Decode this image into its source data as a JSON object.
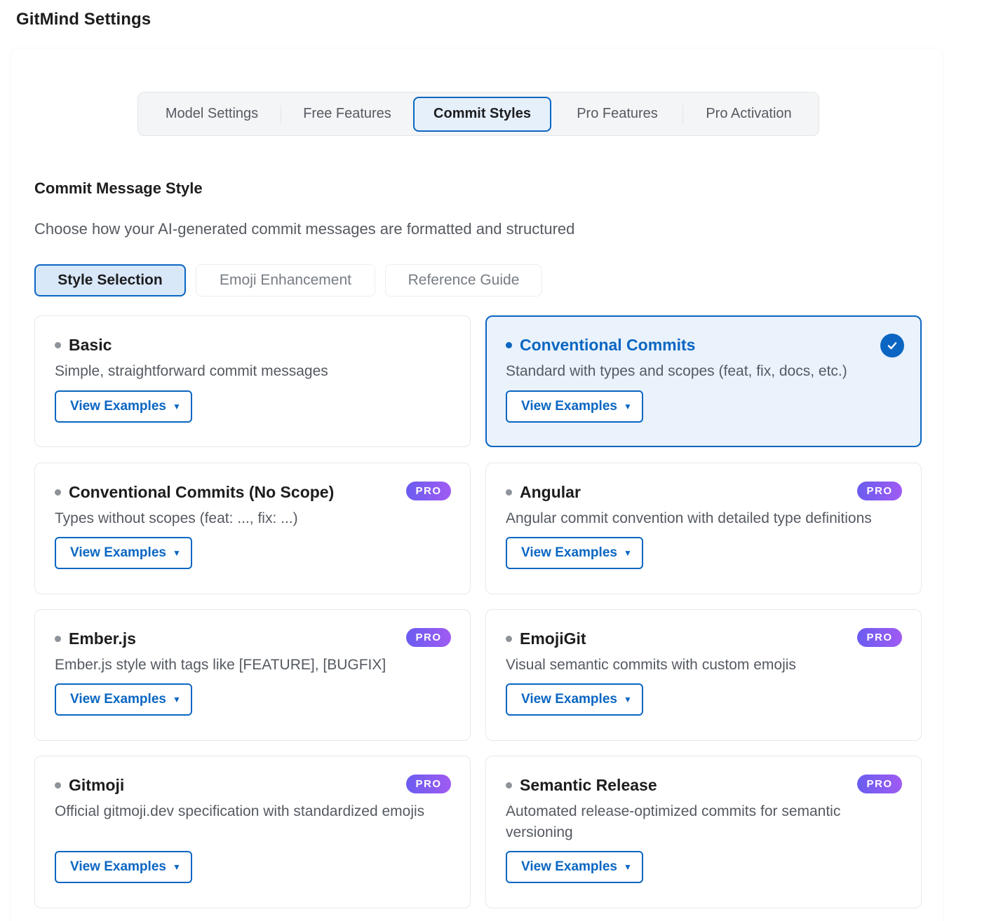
{
  "header": {
    "title": "GitMind Settings"
  },
  "main_tabs": [
    {
      "label": "Model Settings",
      "active": false
    },
    {
      "label": "Free Features",
      "active": false
    },
    {
      "label": "Commit Styles",
      "active": true
    },
    {
      "label": "Pro Features",
      "active": false
    },
    {
      "label": "Pro Activation",
      "active": false
    }
  ],
  "section": {
    "title": "Commit Message Style",
    "description": "Choose how your AI-generated commit messages are formatted and structured"
  },
  "sub_tabs": [
    {
      "label": "Style Selection",
      "active": true
    },
    {
      "label": "Emoji Enhancement",
      "active": false
    },
    {
      "label": "Reference Guide",
      "active": false
    }
  ],
  "view_examples_label": "View Examples",
  "caret_glyph": "▼",
  "pro_label": "PRO",
  "styles": [
    {
      "title": "Basic",
      "description": "Simple, straightforward commit messages",
      "pro": false,
      "selected": false
    },
    {
      "title": "Conventional Commits",
      "description": "Standard with types and scopes (feat, fix, docs, etc.)",
      "pro": false,
      "selected": true
    },
    {
      "title": "Conventional Commits (No Scope)",
      "description": "Types without scopes (feat: ..., fix: ...)",
      "pro": true,
      "selected": false
    },
    {
      "title": "Angular",
      "description": "Angular commit convention with detailed type definitions",
      "pro": true,
      "selected": false
    },
    {
      "title": "Ember.js",
      "description": "Ember.js style with tags like [FEATURE], [BUGFIX]",
      "pro": true,
      "selected": false
    },
    {
      "title": "EmojiGit",
      "description": "Visual semantic commits with custom emojis",
      "pro": true,
      "selected": false
    },
    {
      "title": "Gitmoji",
      "description": "Official gitmoji.dev specification with standardized emojis",
      "pro": true,
      "selected": false
    },
    {
      "title": "Semantic Release",
      "description": "Automated release-optimized commits for semantic versioning",
      "pro": true,
      "selected": false
    }
  ],
  "colors": {
    "accent": "#0a66c2",
    "selected_bg": "#eaf2fc",
    "pro_gradient_start": "#6a5cf0",
    "pro_gradient_end": "#a05bf3"
  },
  "icons": {
    "selected_indicator": "check-circle-icon",
    "dropdown": "caret-down-icon"
  }
}
